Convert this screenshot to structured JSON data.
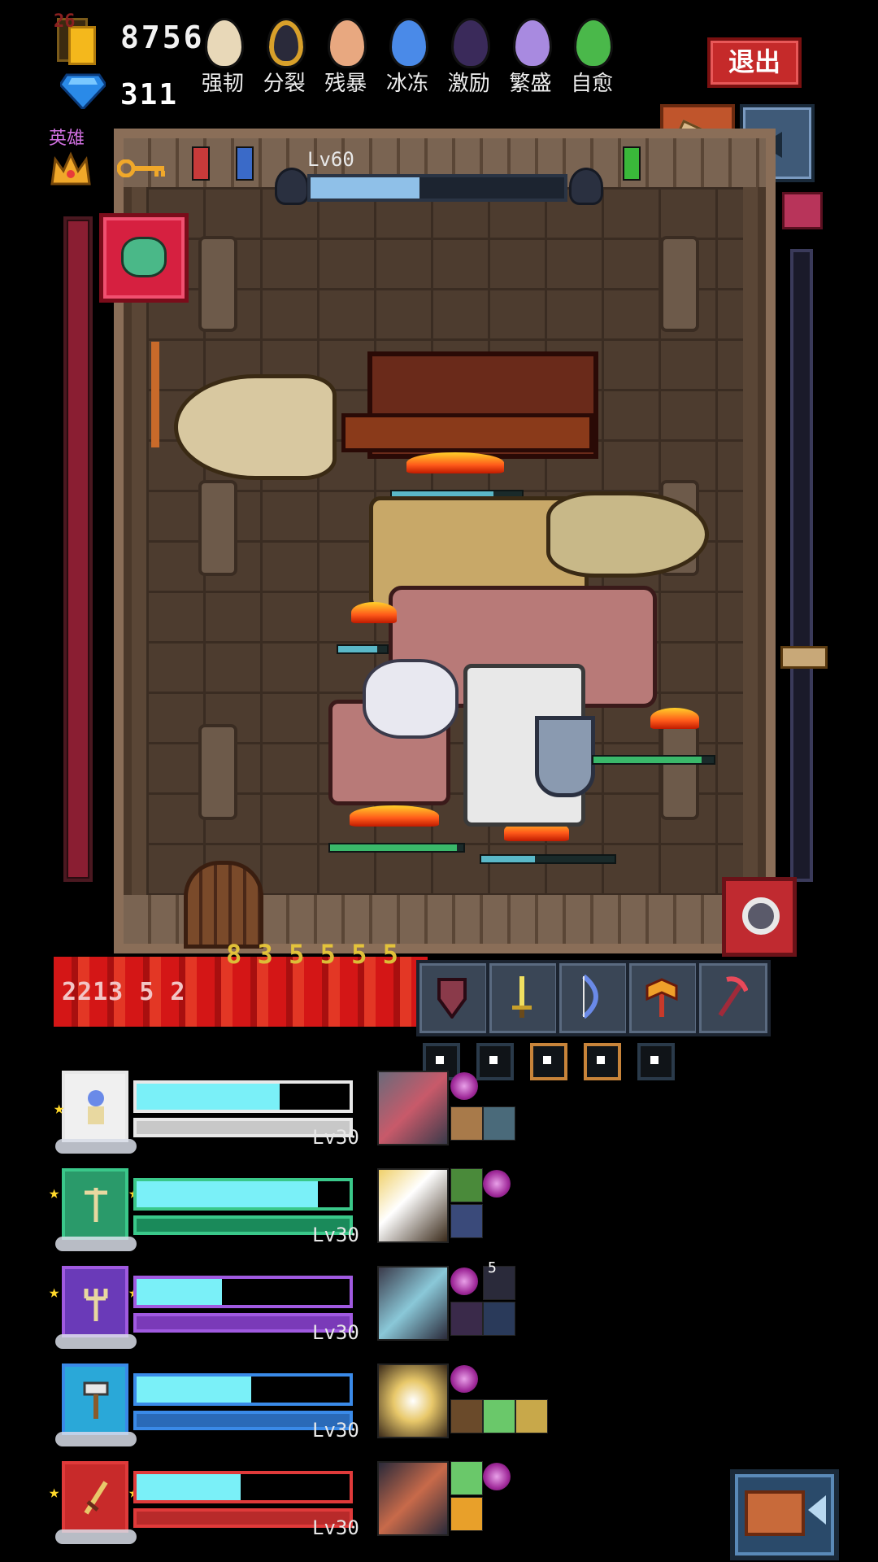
{
  "resources": {
    "gold_level": "26",
    "gold": "8756",
    "gems": "311"
  },
  "eggs": [
    {
      "name": "强韧",
      "color": "#e8d8b8"
    },
    {
      "name": "分裂",
      "color": "#2a2a3a"
    },
    {
      "name": "残暴",
      "color": "#e8a880"
    },
    {
      "name": "冰冻",
      "color": "#4a8ae8"
    },
    {
      "name": "激励",
      "color": "#3a2a5a"
    },
    {
      "name": "繁盛",
      "color": "#a88ae0"
    },
    {
      "name": "自愈",
      "color": "#4ab84a"
    }
  ],
  "buttons": {
    "exit": "退出"
  },
  "hero_label": "英雄",
  "boss": {
    "level": "Lv60",
    "hp_fraction": 0.43
  },
  "weapon_bar": {
    "glitch_numbers": "2213 5 2",
    "glitch_overlay": "8 3 5 5 5 5",
    "slots": [
      "shield-icon",
      "sword-icon",
      "bow-icon",
      "axe-icon",
      "pickaxe-icon"
    ],
    "selected_dots": [
      false,
      false,
      true,
      true,
      false
    ]
  },
  "heroes": [
    {
      "level": "Lv30",
      "color": "#e8e8e8",
      "fill": 0.67,
      "portrait_bg": "#f0f0f0",
      "icon": "mage-icon"
    },
    {
      "level": "Lv30",
      "color": "#3ac88a",
      "fill": 0.85,
      "portrait_bg": "#2a9a6a",
      "icon": "crossbow-icon"
    },
    {
      "level": "Lv30",
      "color": "#a05ae0",
      "fill": 0.4,
      "portrait_bg": "#6a3ab8",
      "icon": "trident-icon"
    },
    {
      "level": "Lv30",
      "color": "#3a8ae8",
      "fill": 0.54,
      "portrait_bg": "#2aa8d8",
      "icon": "hammer-icon"
    },
    {
      "level": "Lv30",
      "color": "#e03a3a",
      "fill": 0.49,
      "portrait_bg": "#c82a2a",
      "icon": "sword-icon"
    }
  ],
  "colors": {
    "hp_fill": "#7af0f8",
    "accent_red": "#c52a2a"
  }
}
